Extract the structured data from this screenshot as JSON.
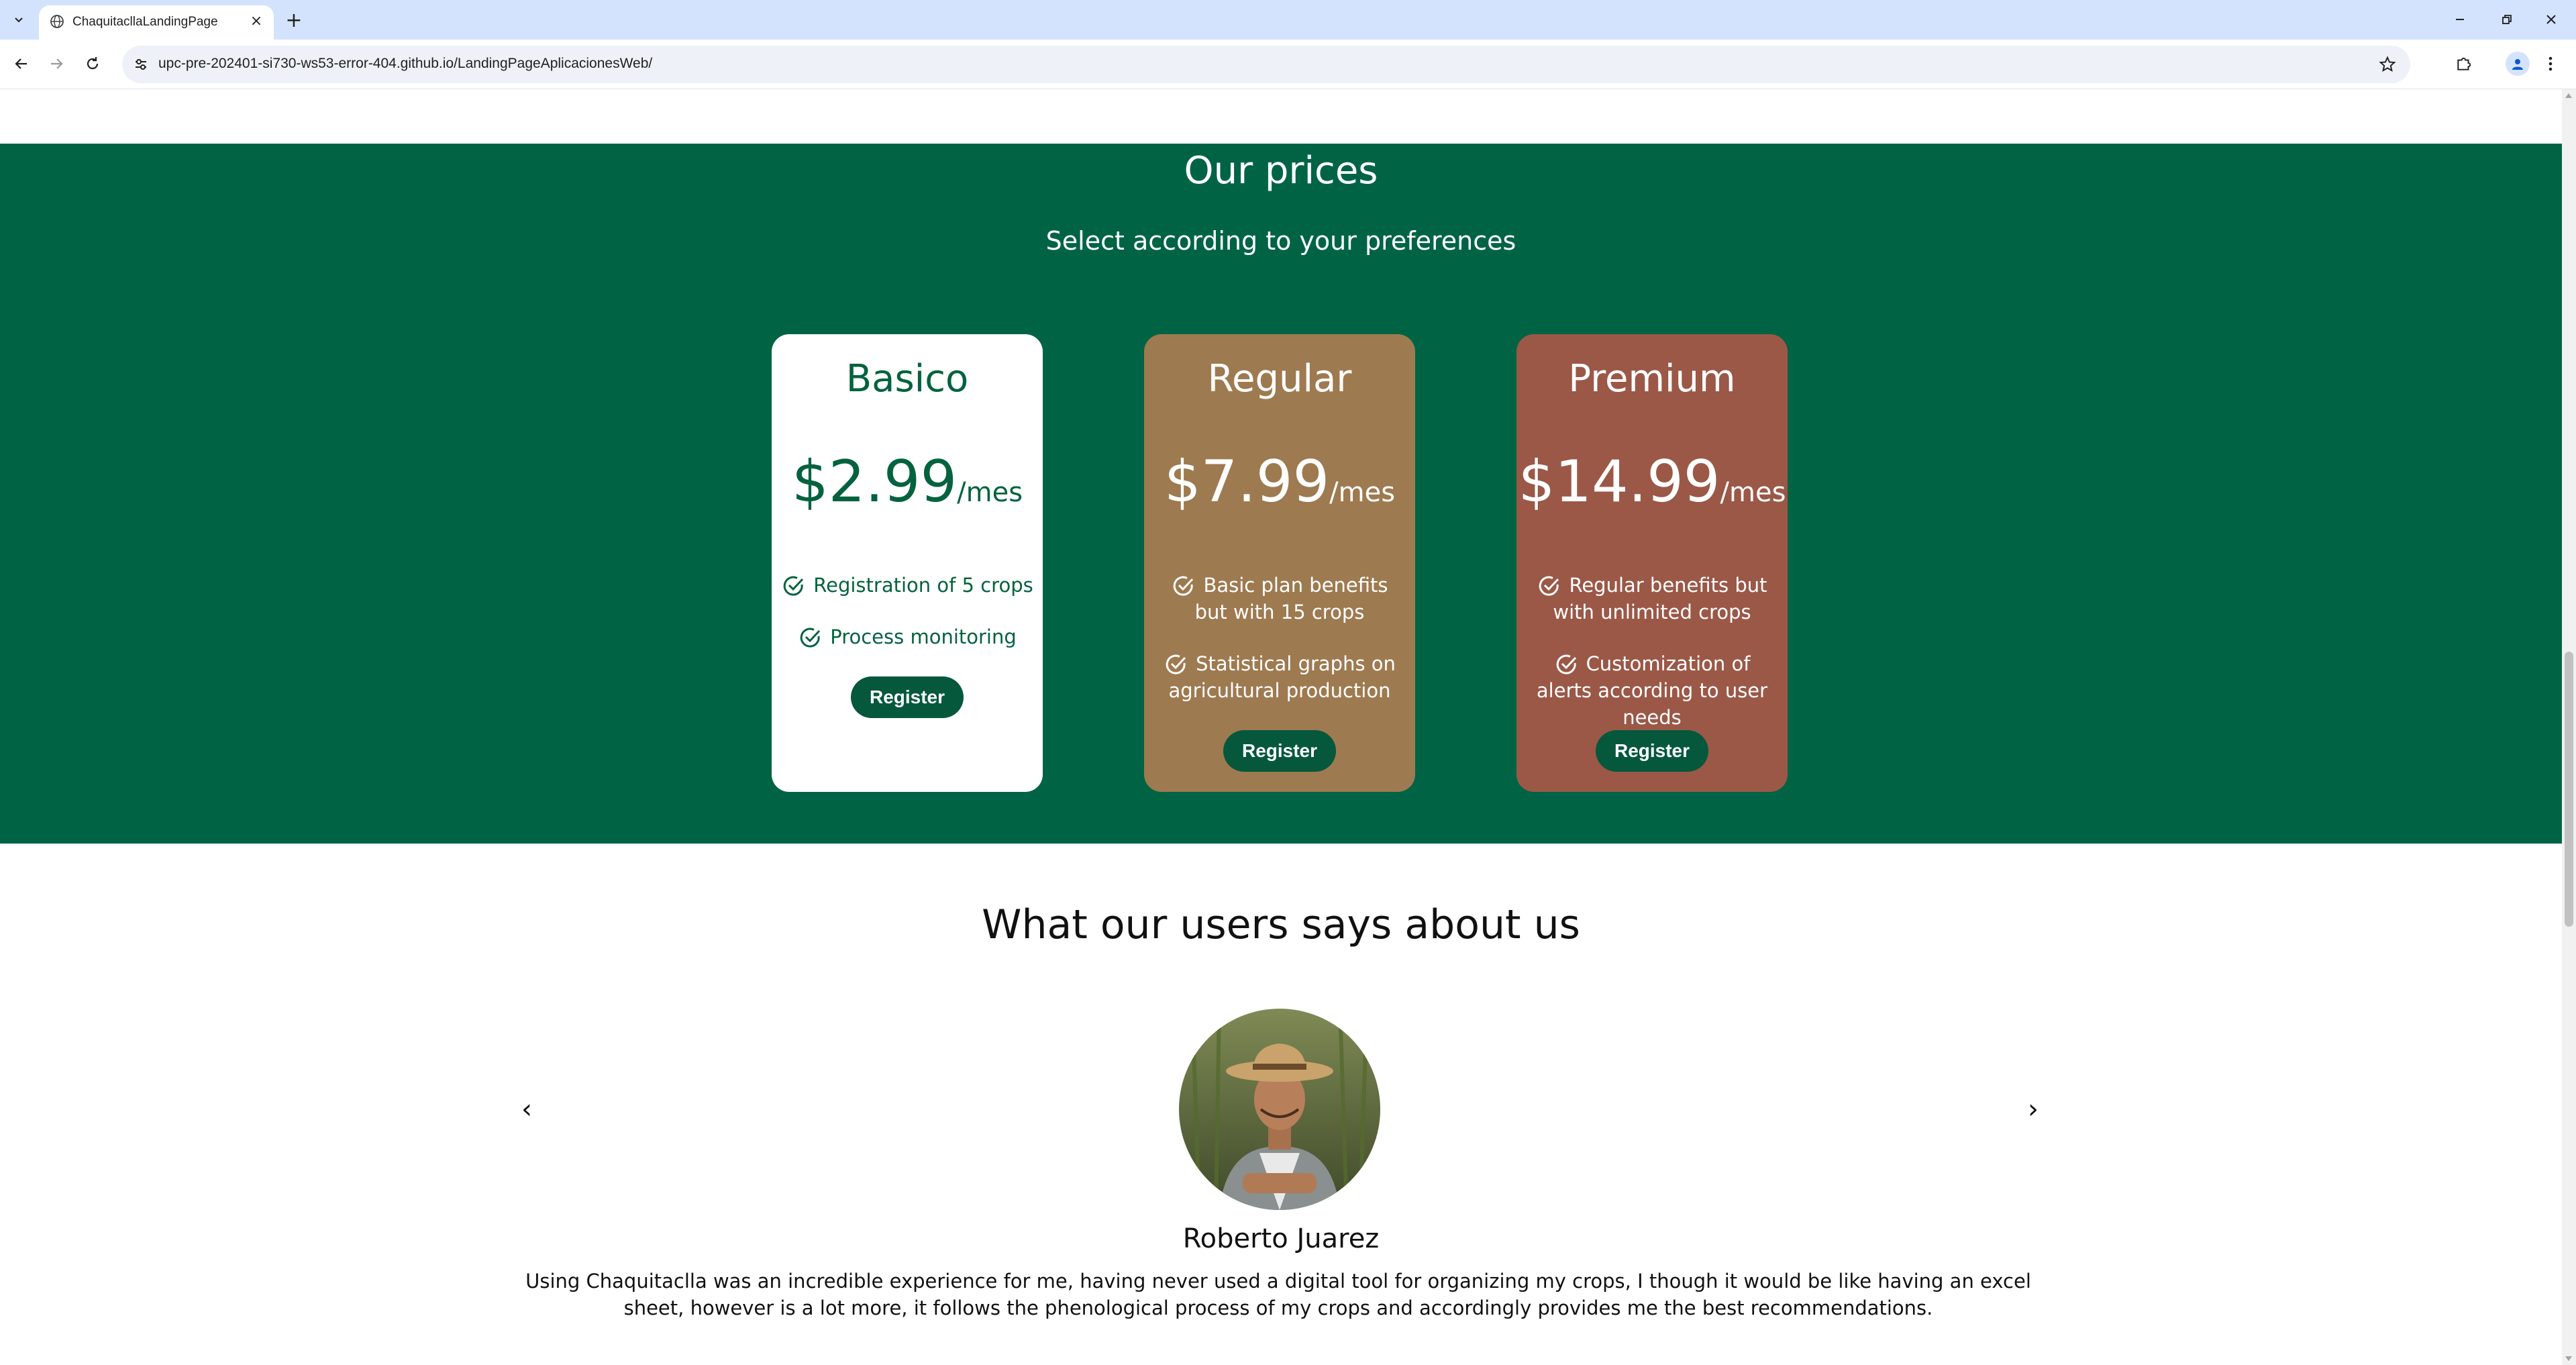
{
  "browser": {
    "tab_title": "ChaquitacllaLandingPage",
    "url": "upc-pre-202401-si730-ws53-error-404.github.io/LandingPageAplicacionesWeb/"
  },
  "prices": {
    "title": "Our prices",
    "subtitle": "Select according to your preferences",
    "plans": [
      {
        "name": "Basico",
        "amount": "$2.99",
        "unit": "/mes",
        "features": [
          "Registration of 5 crops",
          "Process monitoring"
        ],
        "button": "Register"
      },
      {
        "name": "Regular",
        "amount": "$7.99",
        "unit": "/mes",
        "features": [
          "Basic plan benefits but with 15 crops",
          "Statistical graphs on agricultural production"
        ],
        "button": "Register"
      },
      {
        "name": "Premium",
        "amount": "$14.99",
        "unit": "/mes",
        "features": [
          "Regular benefits but with unlimited crops",
          "Customization of alerts according to user needs"
        ],
        "button": "Register"
      }
    ]
  },
  "testimonials": {
    "title": "What our users says about us",
    "prev": "‹",
    "next": "›",
    "current": {
      "name": "Roberto Juarez",
      "text": "Using Chaquitaclla was an incredible experience for me, having never used a digital tool for organizing my crops, I though it would be like having an excel sheet, however is a lot more, it follows the phenological process  of my crops and accordingly provides me the best recommendations."
    }
  },
  "colors": {
    "brand_green": "#006444",
    "regular_card": "#9e7a50",
    "premium_card": "#9b5847",
    "button": "#05583c"
  }
}
